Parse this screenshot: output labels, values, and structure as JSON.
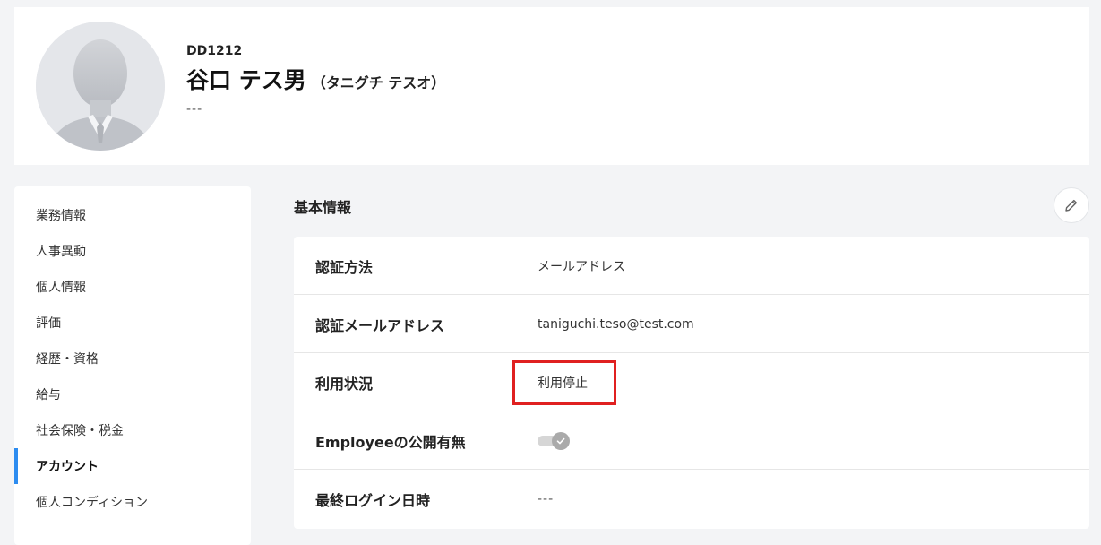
{
  "profile": {
    "employee_code": "DD1212",
    "name": "谷口 テス男",
    "name_kana": "（タニグチ テスオ）",
    "sub_text": "---",
    "avatar_icon": "default-user-avatar"
  },
  "sidebar": {
    "items": [
      {
        "label": "業務情報",
        "active": false
      },
      {
        "label": "人事異動",
        "active": false
      },
      {
        "label": "個人情報",
        "active": false
      },
      {
        "label": "評価",
        "active": false
      },
      {
        "label": "経歴・資格",
        "active": false
      },
      {
        "label": "給与",
        "active": false
      },
      {
        "label": "社会保険・税金",
        "active": false
      },
      {
        "label": "アカウント",
        "active": true
      },
      {
        "label": "個人コンディション",
        "active": false
      }
    ]
  },
  "section": {
    "title": "基本情報",
    "edit_icon": "pencil-icon"
  },
  "info": {
    "auth_method": {
      "label": "認証方法",
      "value": "メールアドレス"
    },
    "auth_email": {
      "label": "認証メールアドレス",
      "value": "taniguchi.teso@test.com"
    },
    "usage_status": {
      "label": "利用状況",
      "value": "利用停止"
    },
    "employee_public": {
      "label": "Employeeの公開有無",
      "toggle_on": true
    },
    "last_login": {
      "label": "最終ログイン日時",
      "value": "---"
    }
  },
  "colors": {
    "accent": "#2d8cf0",
    "highlight": "#e02020",
    "background": "#f3f4f6"
  }
}
